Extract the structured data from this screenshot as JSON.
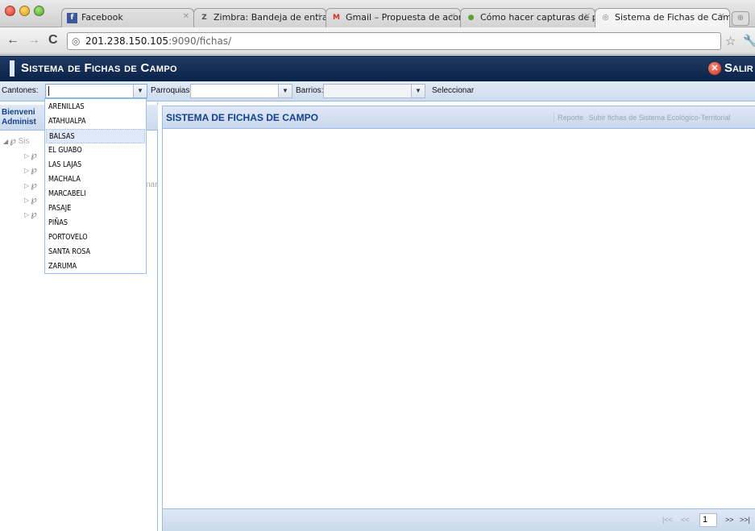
{
  "browser": {
    "tabs": [
      {
        "title": "Facebook",
        "favicon": "f",
        "active": false
      },
      {
        "title": "Zimbra: Bandeja de entrada",
        "favicon": "Z",
        "active": false
      },
      {
        "title": "Gmail – Propuesta de acom",
        "favicon": "M",
        "active": false
      },
      {
        "title": "Cómo hacer capturas de pa",
        "favicon": "●",
        "active": false
      },
      {
        "title": "Sistema de Fichas de Camp",
        "favicon": "◎",
        "active": true
      }
    ],
    "url_host": "201.238.150.105",
    "url_path": ":9090/fichas/"
  },
  "app": {
    "title": "Sistema de Fichas de Campo",
    "logout_label": "Salir"
  },
  "filters": {
    "cantones_label": "Cantones:",
    "cantones_value": "",
    "parroquias_label": "Parroquias:",
    "barrios_label": "Barrios:",
    "select_label": "Seleccionar"
  },
  "cantones_options": [
    "ARENILLAS",
    "ATAHUALPA",
    "BALSAS",
    "EL GUABO",
    "LAS LAJAS",
    "MACHALA",
    "MARCABELI",
    "PASAJE",
    "PIÑAS",
    "PORTOVELO",
    "SANTA ROSA",
    "ZARUMA"
  ],
  "highlighted_option": "BALSAS",
  "left_panel": {
    "welcome_line1": "Bienveni",
    "welcome_line2": "Administ",
    "tree_root": "Sis",
    "tree_partial": "nar"
  },
  "main_panel": {
    "title": "SISTEMA DE FICHAS DE CAMPO",
    "link_reporte": "Reporte",
    "link_subir": "Subir fichas de Sistema Ecológico-Territorial",
    "pager": {
      "first": "|<<",
      "prev": "<<",
      "page": "1",
      "next": ">>",
      "last": ">>|"
    }
  },
  "colors": {
    "header_bg": "#0a2348",
    "panel_title": "#15428b",
    "panel_border": "#99bbe8"
  }
}
